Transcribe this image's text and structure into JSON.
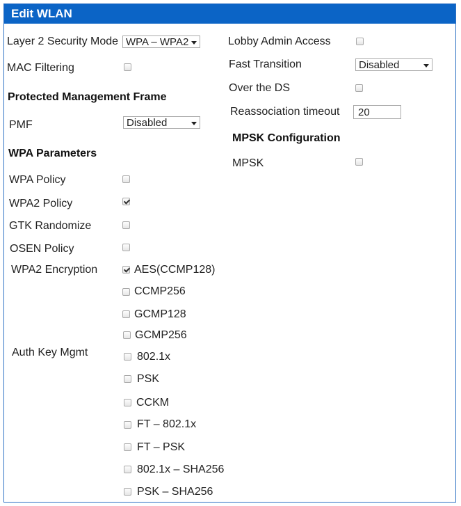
{
  "window": {
    "title": "Edit WLAN"
  },
  "left": {
    "layer2_label": "Layer 2 Security Mode",
    "layer2_value": "WPA – WPA2",
    "mac_filtering_label": "MAC Filtering",
    "pmf_heading": "Protected Management Frame",
    "pmf_label": "PMF",
    "pmf_value": "Disabled",
    "wpa_params_heading": "WPA Parameters",
    "wpa_policy_label": "WPA Policy",
    "wpa2_policy_label": "WPA2 Policy",
    "gtk_label": "GTK Randomize",
    "osen_label": "OSEN Policy",
    "wpa2_enc_label": "WPA2 Encryption",
    "enc_options": [
      "AES(CCMP128)",
      "CCMP256",
      "GCMP128",
      "GCMP256"
    ],
    "auth_key_label": "Auth Key Mgmt",
    "akm_options": [
      "802.1x",
      "PSK",
      "CCKM",
      "FT – 802.1x",
      "FT – PSK",
      "802.1x – SHA256",
      "PSK – SHA256"
    ]
  },
  "right": {
    "lobby_label": "Lobby Admin Access",
    "fast_transition_label": "Fast Transition",
    "fast_transition_value": "Disabled",
    "over_ds_label": "Over the DS",
    "reassoc_label": "Reassociation timeout",
    "reassoc_value": "20",
    "mpsk_heading": "MPSK Configuration",
    "mpsk_label": "MPSK"
  }
}
